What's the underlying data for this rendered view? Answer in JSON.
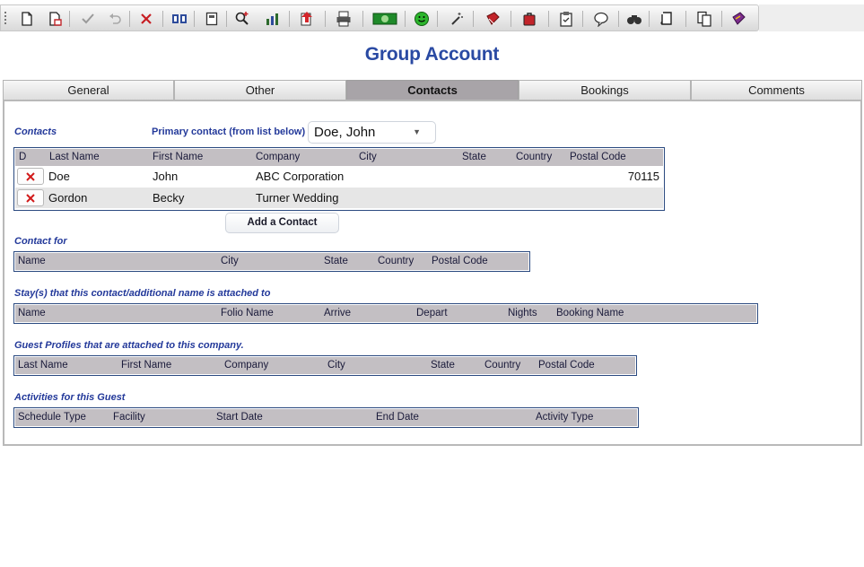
{
  "title": "Group Account",
  "toolbar": {
    "icons": [
      "new-document-icon",
      "new-copy-icon",
      "check-icon",
      "undo-icon",
      "delete-icon",
      "compare-icon",
      "calculator-icon",
      "find-icon",
      "chart-icon",
      "export-icon",
      "print-icon",
      "money-icon",
      "smiley-icon",
      "wand-icon",
      "book-icon",
      "luggage-icon",
      "clipboard-icon",
      "chat-icon",
      "binoculars-icon",
      "scroll-icon",
      "documents-icon",
      "book-purple-icon"
    ]
  },
  "tabs": [
    {
      "label": "General"
    },
    {
      "label": "Other"
    },
    {
      "label": "Contacts"
    },
    {
      "label": "Bookings"
    },
    {
      "label": "Comments"
    }
  ],
  "contacts": {
    "section_label": "Contacts",
    "primary_label": "Primary contact (from list below)",
    "primary_value": "Doe, John",
    "columns": [
      "D",
      "Last Name",
      "First Name",
      "Company",
      "City",
      "State",
      "Country",
      "Postal Code"
    ],
    "rows": [
      {
        "last": "Doe",
        "first": "John",
        "company": "ABC Corporation",
        "city": "",
        "state": "",
        "country": "",
        "postal": "70115"
      },
      {
        "last": "Gordon",
        "first": "Becky",
        "company": "Turner Wedding",
        "city": "",
        "state": "",
        "country": "",
        "postal": ""
      }
    ],
    "add_button": "Add a Contact"
  },
  "contact_for": {
    "label": "Contact for",
    "columns": [
      "Name",
      "City",
      "State",
      "Country",
      "Postal Code"
    ]
  },
  "stays": {
    "label": "Stay(s) that this contact/additional name is attached to",
    "columns": [
      "Name",
      "Folio Name",
      "Arrive",
      "Depart",
      "Nights",
      "Booking Name"
    ]
  },
  "guest_profiles": {
    "label": "Guest Profiles that are attached to this company.",
    "columns": [
      "Last Name",
      "First Name",
      "Company",
      "City",
      "State",
      "Country",
      "Postal Code"
    ]
  },
  "activities": {
    "label": "Activities for this Guest",
    "columns": [
      "Schedule Type",
      "Facility",
      "Start Date",
      "End Date",
      "Activity Type"
    ]
  },
  "colors": {
    "accent": "#2a4aa3",
    "label": "#23399a",
    "active_tab": "#a8a4a8",
    "header": "#c3bfc3",
    "grid_border": "#2b4a80",
    "delete": "#d11a1a"
  }
}
